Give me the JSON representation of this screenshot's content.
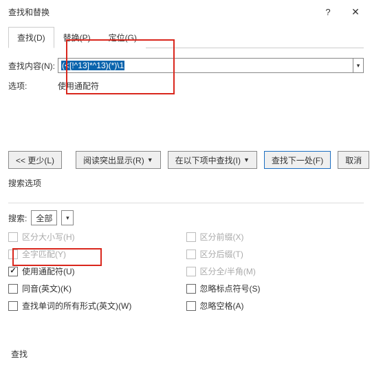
{
  "title": "查找和替换",
  "help_icon": "?",
  "close_icon": "✕",
  "tabs": {
    "find": "查找(D)",
    "replace": "替换(P)",
    "goto": "定位(G)"
  },
  "find_label": "查找内容(N):",
  "find_value": "(<[!^13]*^13)(*)\\1",
  "options_label": "选项:",
  "options_value": "使用通配符",
  "buttons": {
    "less": "<< 更少(L)",
    "highlight": "阅读突出显示(R)",
    "findin": "在以下项中查找(I)",
    "findnext": "查找下一处(F)",
    "cancel": "取消"
  },
  "search_options_title": "搜索选项",
  "search_label": "搜索:",
  "search_value": "全部",
  "checks": {
    "left": [
      {
        "label": "区分大小写(H)",
        "disabled": true,
        "checked": false
      },
      {
        "label": "全字匹配(Y)",
        "disabled": true,
        "checked": false
      },
      {
        "label": "使用通配符(U)",
        "disabled": false,
        "checked": true
      },
      {
        "label": "同音(英文)(K)",
        "disabled": false,
        "checked": false
      },
      {
        "label": "查找单词的所有形式(英文)(W)",
        "disabled": false,
        "checked": false
      }
    ],
    "right": [
      {
        "label": "区分前缀(X)",
        "disabled": true,
        "checked": false
      },
      {
        "label": "区分后缀(T)",
        "disabled": true,
        "checked": false
      },
      {
        "label": "区分全/半角(M)",
        "disabled": true,
        "checked": false
      },
      {
        "label": "忽略标点符号(S)",
        "disabled": false,
        "checked": false
      },
      {
        "label": "忽略空格(A)",
        "disabled": false,
        "checked": false
      }
    ]
  },
  "footer": "查找"
}
